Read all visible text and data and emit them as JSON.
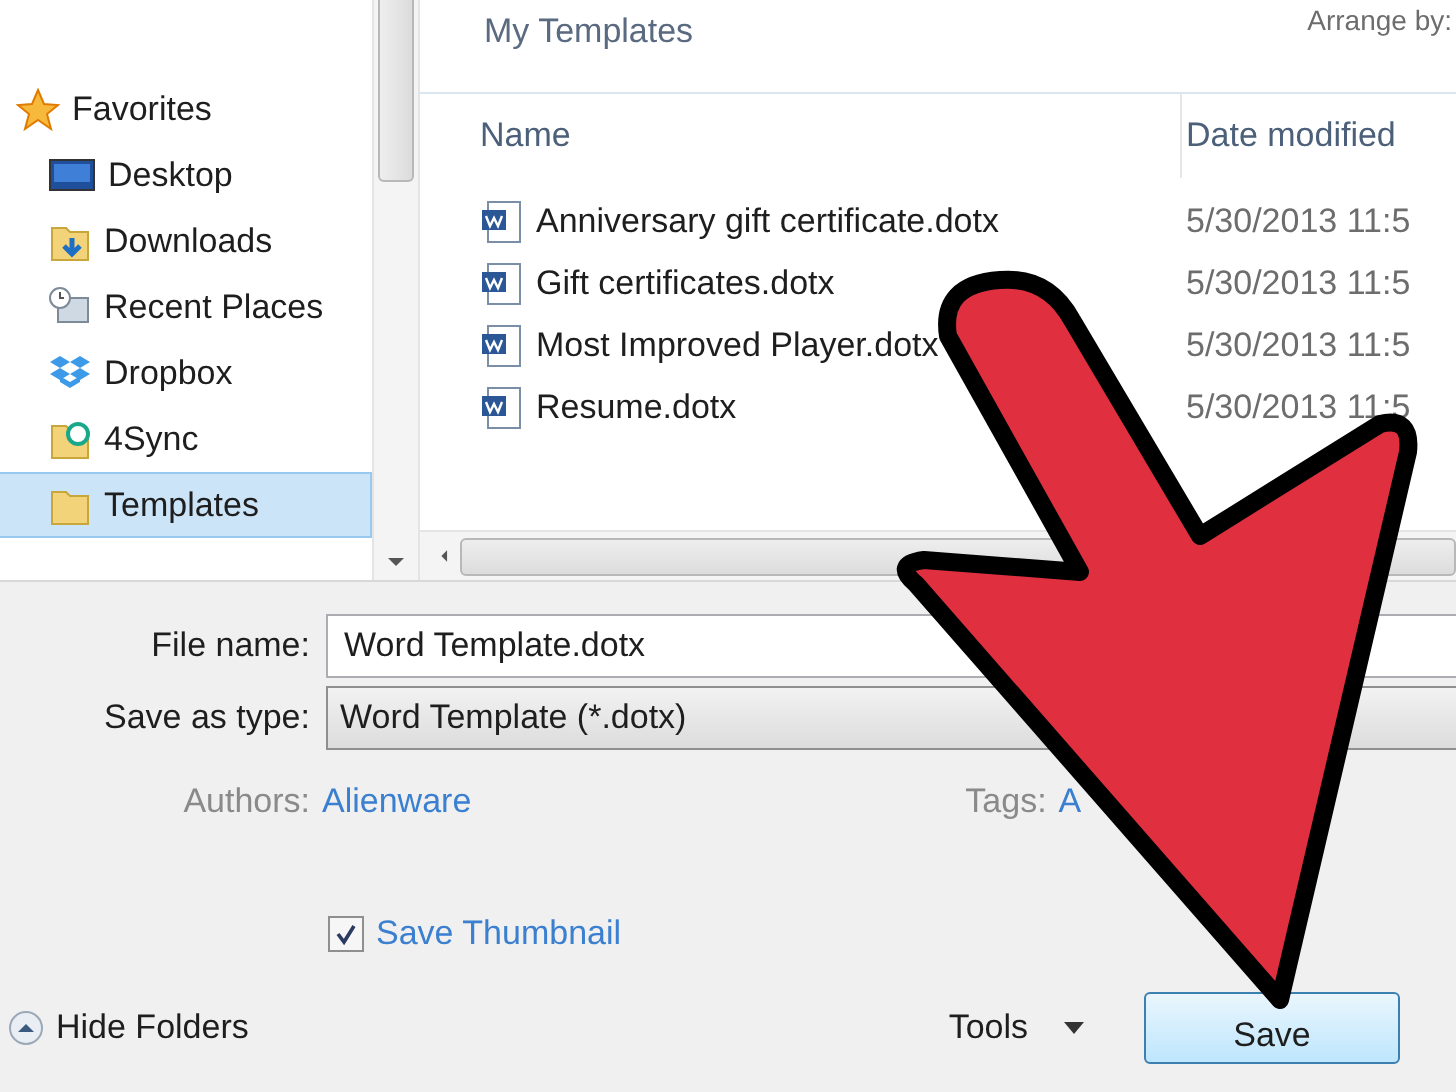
{
  "header": {
    "folder_title": "My Templates",
    "arrange_label": "Arrange by:"
  },
  "sidebar": {
    "items": [
      {
        "label": "Favorites",
        "kind": "favorites",
        "selected": false
      },
      {
        "label": "Desktop",
        "kind": "desktop",
        "selected": false
      },
      {
        "label": "Downloads",
        "kind": "downloads",
        "selected": false
      },
      {
        "label": "Recent Places",
        "kind": "recent",
        "selected": false
      },
      {
        "label": "Dropbox",
        "kind": "dropbox",
        "selected": false
      },
      {
        "label": "4Sync",
        "kind": "sync",
        "selected": false
      },
      {
        "label": "Templates",
        "kind": "folder",
        "selected": true
      }
    ]
  },
  "files": {
    "columns": [
      "Name",
      "Date modified"
    ],
    "rows": [
      {
        "name": "Anniversary gift certificate.dotx",
        "date": "5/30/2013 11:5"
      },
      {
        "name": "Gift certificates.dotx",
        "date": "5/30/2013 11:5"
      },
      {
        "name": "Most Improved Player.dotx",
        "date": "5/30/2013 11:5"
      },
      {
        "name": "Resume.dotx",
        "date": "5/30/2013 11:5"
      }
    ]
  },
  "form": {
    "file_name": {
      "label": "File name:",
      "value": "Word Template.dotx"
    },
    "save_as_type": {
      "label": "Save as type:",
      "value": "Word Template (*.dotx)"
    },
    "authors": {
      "label": "Authors:",
      "value": "Alienware"
    },
    "tags": {
      "label": "Tags:",
      "value": "A"
    },
    "save_thumbnail": {
      "label": "Save Thumbnail",
      "checked": true
    }
  },
  "footer": {
    "hide_folders": "Hide Folders",
    "tools": "Tools",
    "save": "Save"
  }
}
